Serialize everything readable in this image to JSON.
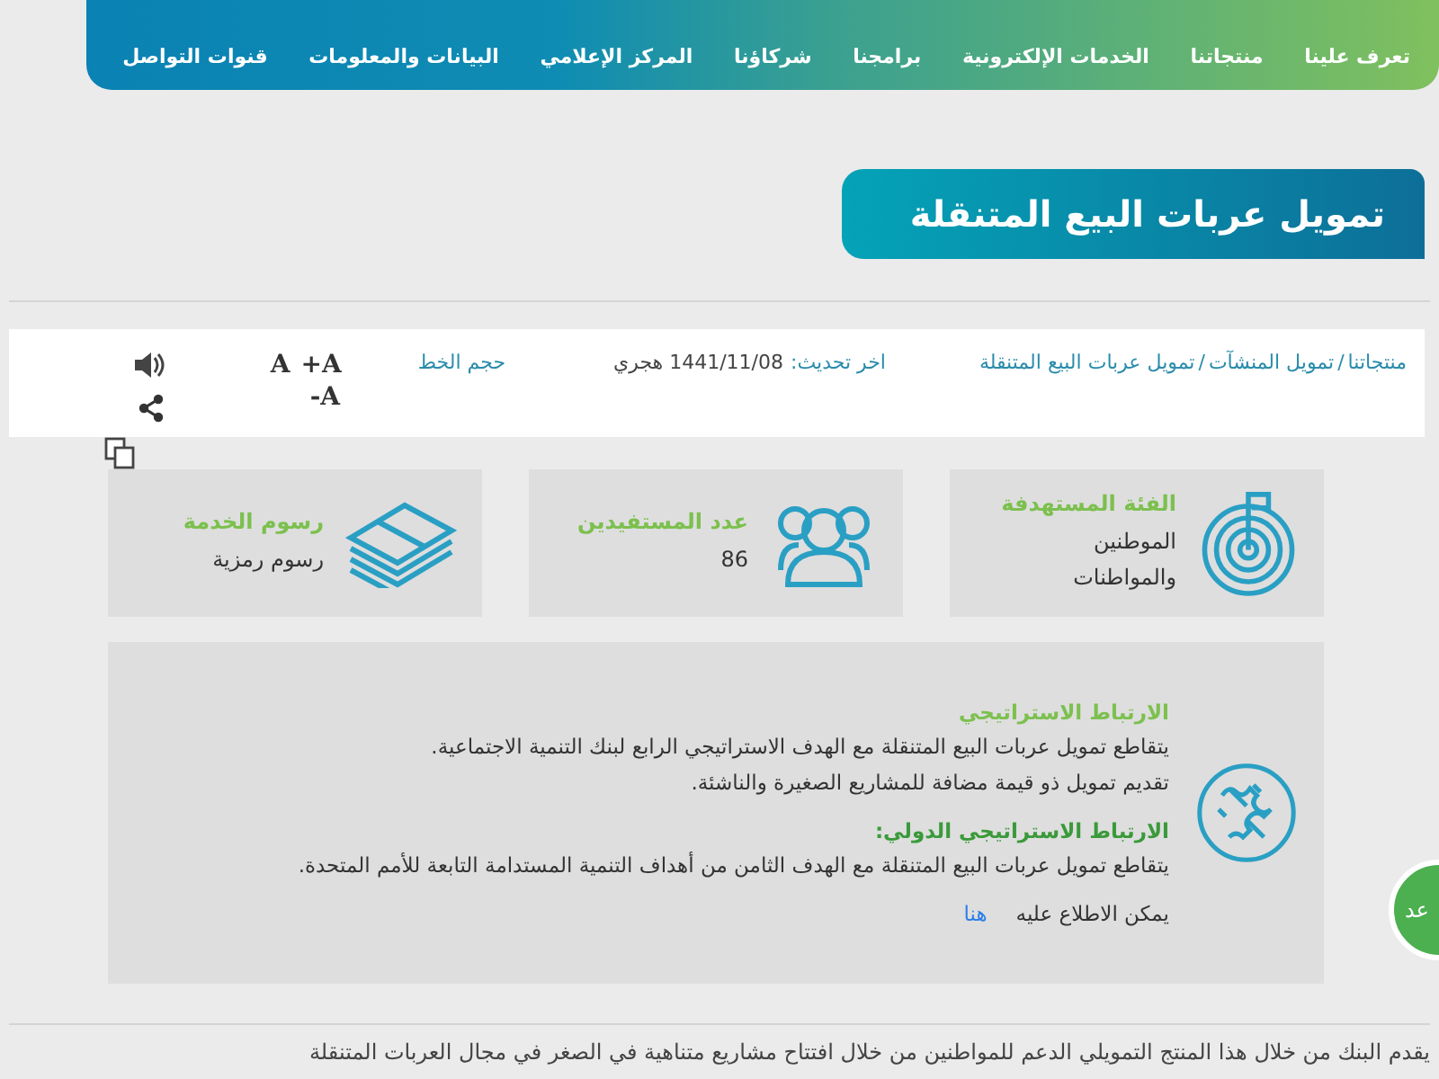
{
  "nav": {
    "items": [
      {
        "label": "تعرف علينا"
      },
      {
        "label": "منتجاتنا"
      },
      {
        "label": "الخدمات الإلكترونية"
      },
      {
        "label": "برامجنا"
      },
      {
        "label": "شركاؤنا"
      },
      {
        "label": "المركز الإعلامي"
      },
      {
        "label": "البيانات والمعلومات"
      },
      {
        "label": "قنوات التواصل"
      }
    ]
  },
  "page_title": "تمويل عربات البيع المتنقلة",
  "info_bar": {
    "breadcrumb": [
      {
        "label": "منتجاتنا"
      },
      {
        "label": "تمويل المنشآت"
      },
      {
        "label": "تمويل عربات البيع المتنقلة"
      }
    ],
    "separator": "/",
    "updated_label": "اخر تحديث:",
    "updated_value": "1441/11/08 هجري",
    "font_size_label": "حجم الخط",
    "font_buttons": [
      {
        "label": "A",
        "kind": "plus",
        "sign": "+"
      },
      {
        "label": "A",
        "kind": "normal"
      },
      {
        "label": "A",
        "kind": "minus",
        "sign": "-"
      }
    ]
  },
  "cards": [
    {
      "kind": "target",
      "title": "الفئة المستهدفة",
      "lines": [
        "الموطنين",
        "والمواطنات"
      ]
    },
    {
      "kind": "people",
      "title": "عدد المستفيدين",
      "lines": [
        "86"
      ]
    },
    {
      "kind": "money",
      "title": "رسوم الخدمة",
      "lines": [
        "رسوم رمزية"
      ]
    }
  ],
  "strategy": {
    "sections": [
      {
        "title": "الارتباط الاستراتيجي",
        "paragraphs": [
          "يتقاطع تمويل عربات البيع المتنقلة مع الهدف الاستراتيجي الرابع لبنك التنمية الاجتماعية.",
          "تقديم تمويل ذو قيمة مضافة للمشاريع الصغيرة والناشئة."
        ]
      },
      {
        "title": "الارتباط الاستراتيجي الدولي:",
        "paragraphs": [
          "يتقاطع تمويل عربات البيع المتنقلة مع الهدف الثامن من أهداف التنمية المستدامة التابعة للأمم المتحدة."
        ]
      }
    ],
    "more_text": "يمكن الاطلاع عليه",
    "more_link": "هنا"
  },
  "body_text": "يقدم البنك من خلال هذا المنتج التمويلي الدعم للمواطنين من خلال افتتاح مشاريع متناهية في الصغر في مجال العربات المتنقلة",
  "chat_widget": {
    "label": "عد"
  }
}
